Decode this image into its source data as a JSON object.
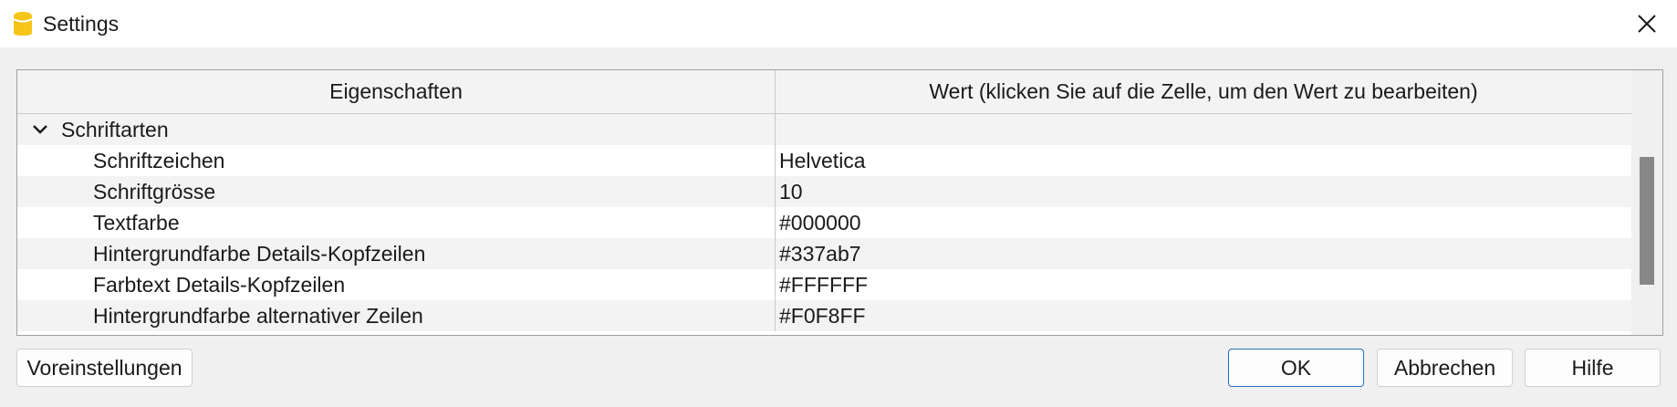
{
  "window": {
    "title": "Settings",
    "app_icon": "app-logo-icon",
    "close_icon": "close-icon"
  },
  "grid": {
    "columns": [
      "Eigenschaften",
      "Wert (klicken Sie auf die Zelle, um den Wert zu bearbeiten)"
    ],
    "group": {
      "label": "Schriftarten",
      "expanded": true,
      "icon": "chevron-down-icon"
    },
    "rows": [
      {
        "property": "Schriftzeichen",
        "value": "Helvetica"
      },
      {
        "property": "Schriftgrösse",
        "value": "10"
      },
      {
        "property": "Textfarbe",
        "value": "#000000"
      },
      {
        "property": "Hintergrundfarbe Details-Kopfzeilen",
        "value": "#337ab7"
      },
      {
        "property": "Farbtext Details-Kopfzeilen",
        "value": "#FFFFFF"
      },
      {
        "property": "Hintergrundfarbe alternativer Zeilen",
        "value": "#F0F8FF"
      }
    ]
  },
  "buttons": {
    "defaults": "Voreinstellungen",
    "ok": "OK",
    "cancel": "Abbrechen",
    "help": "Hilfe"
  },
  "colors": {
    "window_bg": "#f0f0f0",
    "alt_row": "#f3f3f3",
    "ok_border": "#2c6fb8",
    "app_icon": "#f5c518"
  }
}
